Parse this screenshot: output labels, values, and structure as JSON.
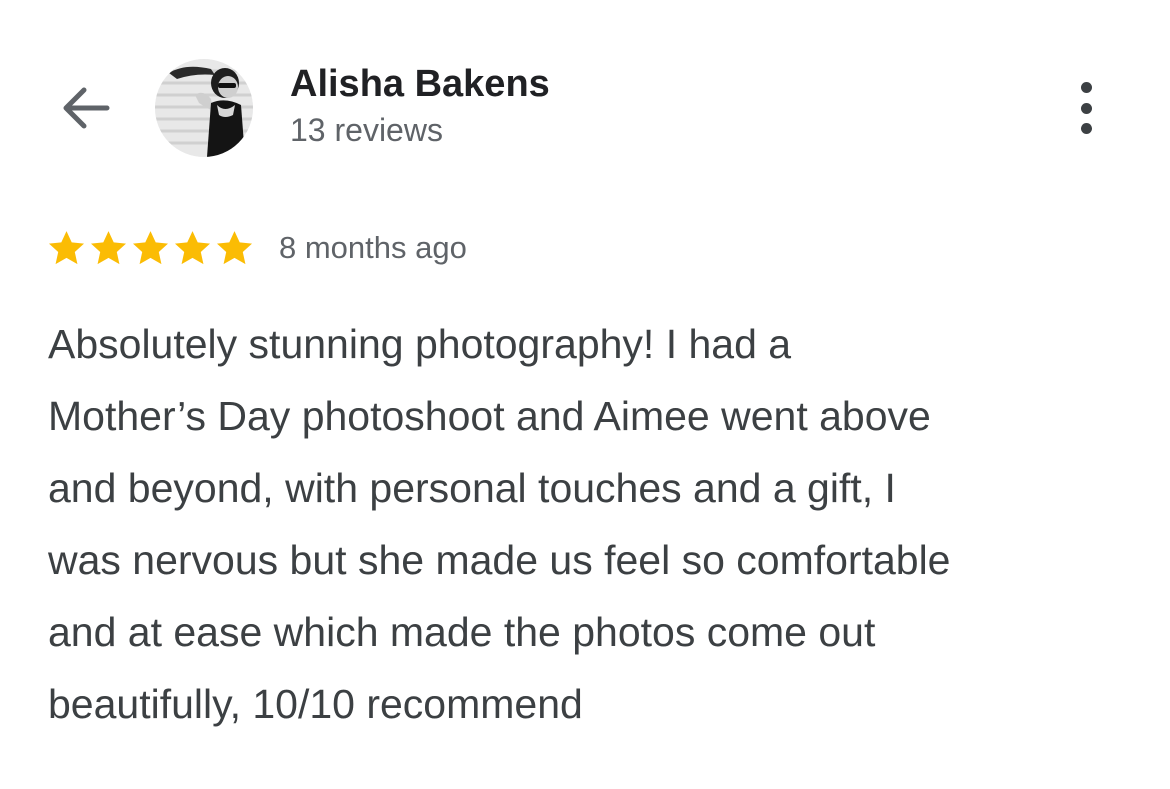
{
  "header": {
    "back_icon": "arrow-back-icon",
    "avatar_icon": "user-avatar",
    "reviewer_name": "Alisha Bakens",
    "review_count": "13 reviews",
    "more_icon": "more-vert-icon"
  },
  "review": {
    "rating": 5,
    "rating_max": 5,
    "star_color": "#FBBC04",
    "time_ago": "8 months ago",
    "text_lines": [
      "Absolutely stunning photography! I had a",
      "Mother’s Day photoshoot and Aimee went above",
      "and beyond, with personal touches and a gift, I",
      "was nervous but she made us feel so comfortable",
      "and at ease which made the photos come out",
      "beautifully, 10/10 recommend"
    ]
  }
}
